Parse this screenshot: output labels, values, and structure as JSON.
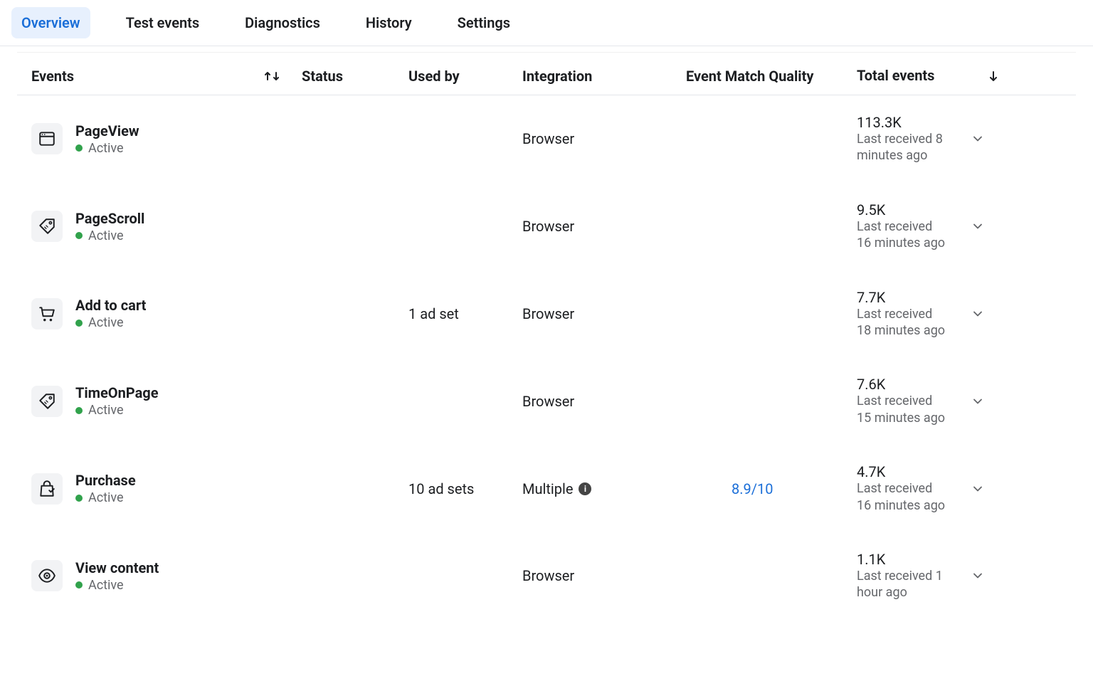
{
  "tabs": [
    {
      "label": "Overview",
      "active": true
    },
    {
      "label": "Test events",
      "active": false
    },
    {
      "label": "Diagnostics",
      "active": false
    },
    {
      "label": "History",
      "active": false
    },
    {
      "label": "Settings",
      "active": false
    }
  ],
  "columns": {
    "events": "Events",
    "status": "Status",
    "used_by": "Used by",
    "integration": "Integration",
    "emq": "Event Match Quality",
    "total": "Total events"
  },
  "rows": [
    {
      "icon": "window-icon",
      "name": "PageView",
      "status": "Active",
      "used_by": "",
      "integration": "Browser",
      "integration_info": false,
      "emq": "",
      "total_count": "113.3K",
      "total_sub": "Last received 8 minutes ago"
    },
    {
      "icon": "tag-icon",
      "name": "PageScroll",
      "status": "Active",
      "used_by": "",
      "integration": "Browser",
      "integration_info": false,
      "emq": "",
      "total_count": "9.5K",
      "total_sub": "Last received 16 minutes ago"
    },
    {
      "icon": "cart-icon",
      "name": "Add to cart",
      "status": "Active",
      "used_by": "1 ad set",
      "integration": "Browser",
      "integration_info": false,
      "emq": "",
      "total_count": "7.7K",
      "total_sub": "Last received 18 minutes ago"
    },
    {
      "icon": "tag-icon",
      "name": "TimeOnPage",
      "status": "Active",
      "used_by": "",
      "integration": "Browser",
      "integration_info": false,
      "emq": "",
      "total_count": "7.6K",
      "total_sub": "Last received 15 minutes ago"
    },
    {
      "icon": "bag-icon",
      "name": "Purchase",
      "status": "Active",
      "used_by": "10 ad sets",
      "integration": "Multiple",
      "integration_info": true,
      "emq": "8.9/10",
      "total_count": "4.7K",
      "total_sub": "Last received 16 minutes ago"
    },
    {
      "icon": "eye-icon",
      "name": "View content",
      "status": "Active",
      "used_by": "",
      "integration": "Browser",
      "integration_info": false,
      "emq": "",
      "total_count": "1.1K",
      "total_sub": "Last received 1 hour ago"
    }
  ]
}
